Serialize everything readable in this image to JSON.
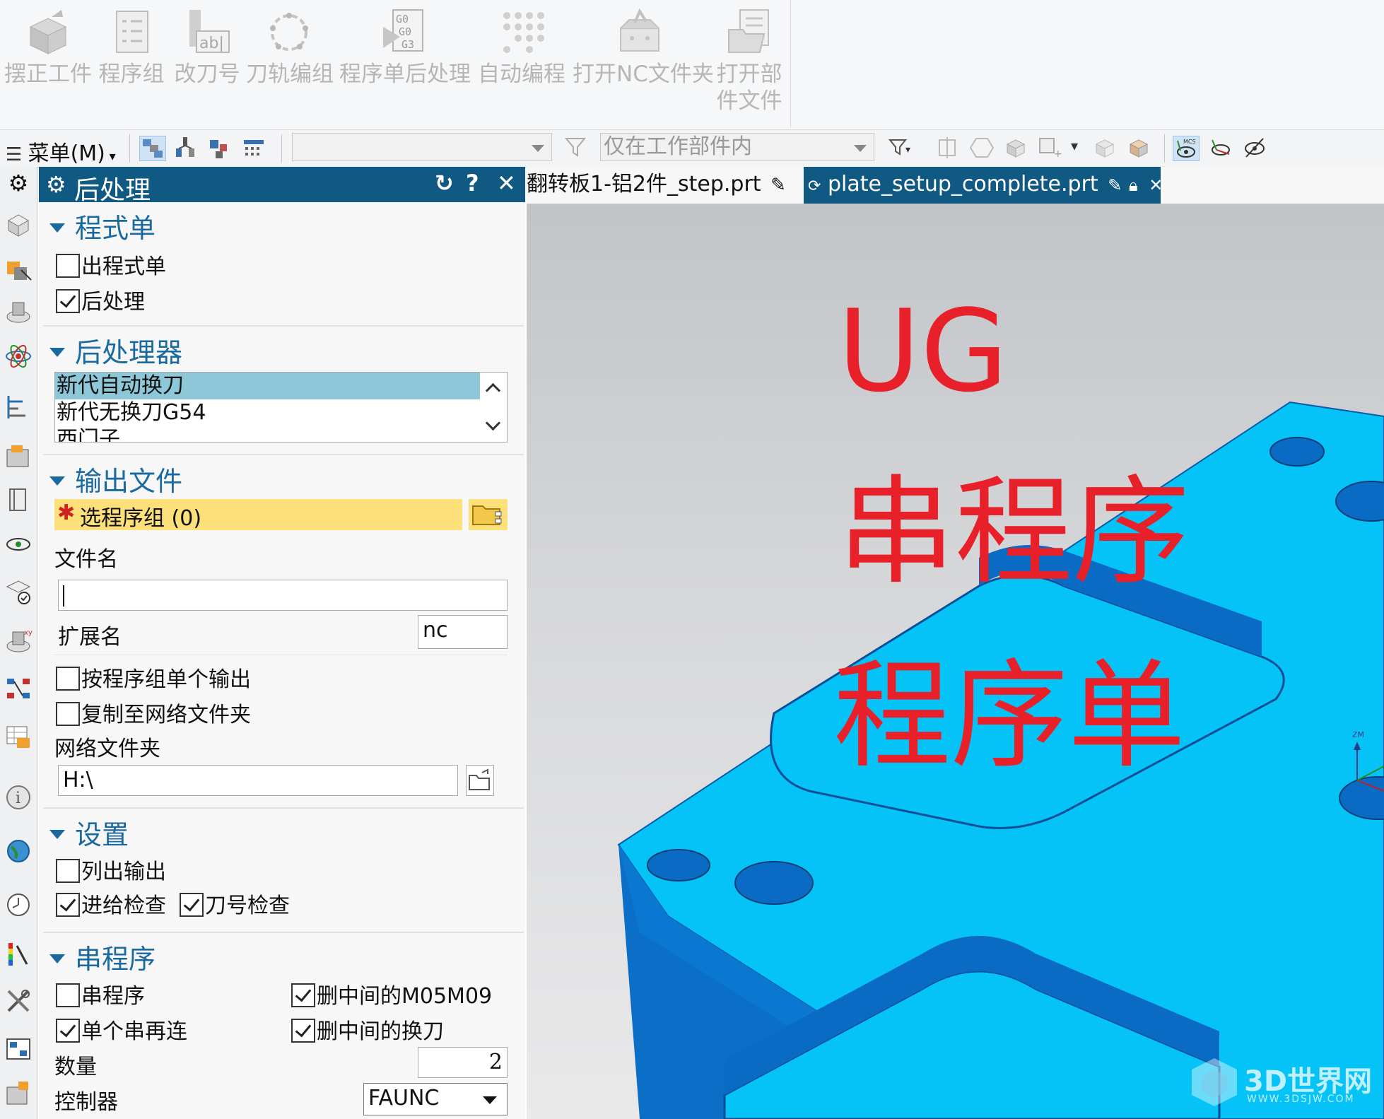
{
  "ribbon": {
    "buttons": [
      {
        "label": "摆正工件",
        "icon": "cube-arrow-icon"
      },
      {
        "label": "程序组",
        "icon": "checklist-icon"
      },
      {
        "label": "改刀号",
        "icon": "rename-tool-icon"
      },
      {
        "label": "刀轨编组",
        "icon": "toolpath-circle-icon"
      },
      {
        "label": "程序单后处理",
        "icon": "gcode-play-icon"
      },
      {
        "label": "自动编程",
        "icon": "dot-grid-icon"
      },
      {
        "label": "打开NC文件夹",
        "icon": "open-box-icon"
      },
      {
        "label": "打开部",
        "label2": "件文件",
        "icon": "open-part-icon"
      }
    ]
  },
  "toolbar": {
    "menu_label": "菜单(M)",
    "filter_combo_value": "",
    "scope_combo_value": "仅在工作部件内"
  },
  "dialog": {
    "title": "后处理",
    "sections": {
      "program_sheet": {
        "title": "程式单",
        "out_sheet": {
          "label": "出程式单",
          "checked": false
        },
        "post_process": {
          "label": "后处理",
          "checked": true
        }
      },
      "postprocessor": {
        "title": "后处理器",
        "items": [
          "新代自动换刀",
          "新代无换刀G54",
          "西门子"
        ],
        "selected": "新代自动换刀"
      },
      "output_file": {
        "title": "输出文件",
        "select_group": "选程序组 (0)",
        "required_mark": "✱",
        "filename_label": "文件名",
        "filename_value": "",
        "ext_label": "扩展名",
        "ext_value": "nc",
        "by_group": {
          "label": "按程序组单个输出",
          "checked": false
        },
        "copy_network": {
          "label": "复制至网络文件夹",
          "checked": false
        },
        "network_label": "网络文件夹",
        "network_value": "H:\\"
      },
      "settings": {
        "title": "设置",
        "list_output": {
          "label": "列出输出",
          "checked": false
        },
        "feed_check": {
          "label": "进给检查",
          "checked": true
        },
        "tool_check": {
          "label": "刀号检查",
          "checked": true
        }
      },
      "chain": {
        "title": "串程序",
        "chain_program": {
          "label": "串程序",
          "checked": false
        },
        "del_m05m09": {
          "label": "删中间的M05M09",
          "checked": true
        },
        "single_chain": {
          "label": "单个串再连",
          "checked": true
        },
        "del_toolchange": {
          "label": "删中间的换刀",
          "checked": true
        },
        "count_label": "数量",
        "count_value": "2",
        "controller_label": "控制器",
        "controller_value": "FAUNC"
      }
    }
  },
  "tabs": [
    {
      "label": "翻转板1-铝2件_step.prt"
    },
    {
      "label": "plate_setup_complete.prt"
    }
  ],
  "overlay": {
    "line1": "UG",
    "line2": "串程序",
    "line3": "程序单",
    "watermark_text": "3D世界网",
    "watermark_url": "WWW.3DSJW.COM",
    "axis_label": "ZM"
  },
  "colors": {
    "title_bar": "#0f5983",
    "section_head": "#1a6aa0",
    "required_field": "#fde07a",
    "list_selected": "#8ec8d8",
    "part_top": "#05c3f7",
    "part_side": "#0b6fc8",
    "overlay_text": "#e8202a"
  }
}
